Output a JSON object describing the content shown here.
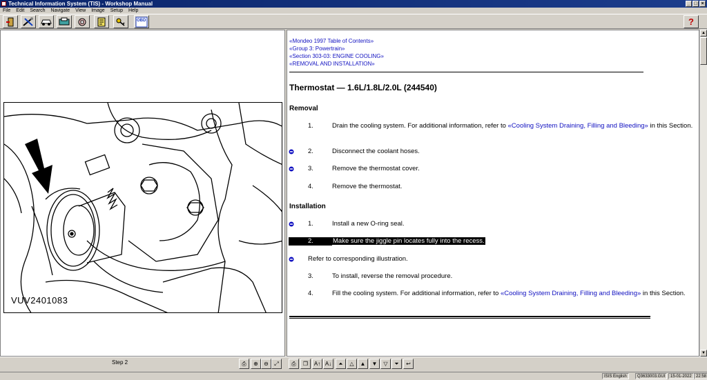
{
  "window": {
    "title": "Technical Information System (TIS) - Workshop Manual",
    "controls": [
      "_",
      "□",
      "×"
    ]
  },
  "menu": [
    "File",
    "Edit",
    "Search",
    "Navigate",
    "View",
    "Image",
    "Setup",
    "Help"
  ],
  "toolbar": {
    "buttons": [
      "exit-icon",
      "tools-icon",
      "car-icon",
      "vehicle-info-icon",
      "component-icon",
      "document-icon",
      "key-icon",
      "obd-icon"
    ],
    "obd_label": "OBD",
    "help_label": "?"
  },
  "illustration": {
    "label": "VUV2401083"
  },
  "breadcrumbs": [
    "«Mondeo 1997 Table of Contents»",
    "«Group 3: Powertrain»",
    "«Section 303-03: ENGINE COOLING»",
    "«REMOVAL AND INSTALLATION»"
  ],
  "document": {
    "title": "Thermostat — 1.6L/1.8L/2.0L (244540)",
    "removal_heading": "Removal",
    "removal_steps": [
      {
        "num": "1.",
        "pre": "Drain the cooling system. For additional information, refer to ",
        "link": "«Cooling System Draining, Filling and Bleeding»",
        "post": " in this Section.",
        "bullet": false
      },
      {
        "num": "2.",
        "pre": "Disconnect the coolant hoses.",
        "link": "",
        "post": "",
        "bullet": true
      },
      {
        "num": "3.",
        "pre": "Remove the thermostat cover.",
        "link": "",
        "post": "",
        "bullet": true
      },
      {
        "num": "4.",
        "pre": "Remove the thermostat.",
        "link": "",
        "post": "",
        "bullet": false
      }
    ],
    "installation_heading": "Installation",
    "inst_step1": {
      "num": "1.",
      "text": "Install a new O-ring seal."
    },
    "inst_step2": {
      "num": "2.",
      "text": "Make sure the jiggle pin locates fully into the recess."
    },
    "refer_note": "Refer to corresponding illustration.",
    "inst_step3": {
      "num": "3.",
      "text": "To install, reverse the removal procedure."
    },
    "inst_step4": {
      "num": "4.",
      "pre": "Fill the cooling system. For additional information, refer to ",
      "link": "«Cooling System Draining, Filling and Bleeding»",
      "post": " in this Section."
    }
  },
  "bottom": {
    "step_label": "Step 2"
  },
  "status": {
    "language": "ISIS English",
    "file": "Q3633003.GUI",
    "date": "15-01-2022",
    "time": "22:58"
  },
  "colors": {
    "link": "#1010c0",
    "bullet": "#1010c0",
    "active_bullet": "#c8a000",
    "titlebar": "#0a246a"
  }
}
